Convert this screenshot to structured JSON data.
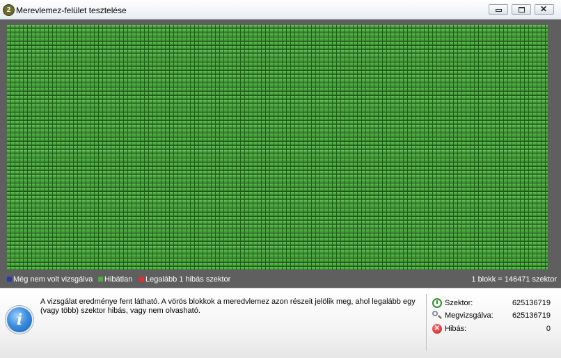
{
  "window": {
    "title": "Merevlemez-felület tesztelése",
    "app_icon_text": "2",
    "buttons": [
      "minimize-icon",
      "maximize-icon",
      "close-icon"
    ]
  },
  "map": {
    "colors": {
      "background": "#5f5f5f",
      "block_ok": "#4cae3e",
      "not_scanned": "#2c3aa0",
      "error": "#e03030"
    },
    "legend": [
      {
        "label": "Még nem volt vizsgálva",
        "color": "#2c3aa0"
      },
      {
        "label": "Hibátlan",
        "color": "#4cae3e"
      },
      {
        "label": "Legalább 1 hibás szektor",
        "color": "#e03030"
      }
    ],
    "block_info": "1 blokk = 146471 szektor"
  },
  "info": {
    "icon": "info-icon",
    "message": "A vizsgálat eredménye fent látható. A vörös blokkok a meredvlemez azon részeit jelölik meg, ahol legalább egy (vagy több) szektor hibás, vagy nem olvasható.",
    "stats": [
      {
        "label": "Szektor:",
        "value": "625136719",
        "icon": "sector-icon"
      },
      {
        "label": "Megvizsgálva:",
        "value": "625136719",
        "icon": "magnifier-icon"
      },
      {
        "label": "Hibás:",
        "value": "0",
        "icon": "error-icon"
      }
    ]
  }
}
